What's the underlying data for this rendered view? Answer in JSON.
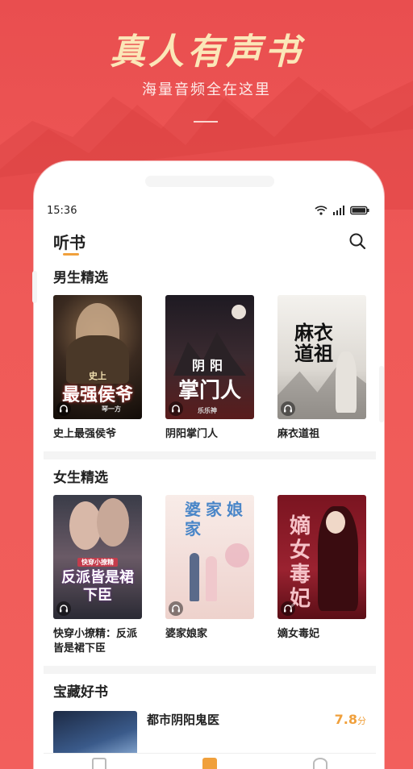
{
  "promo": {
    "title": "真人有声书",
    "subtitle": "海量音频全在这里"
  },
  "status_bar": {
    "time": "15:36"
  },
  "header": {
    "title": "听书"
  },
  "sections": [
    {
      "title": "男生精选",
      "books": [
        {
          "title": "史上最强侯爷",
          "cover_text": "最强侯爷",
          "cover_badge": "史上",
          "cover_author": "琴一方"
        },
        {
          "title": "阴阳掌门人",
          "cover_text": "掌门人",
          "cover_badge": "阴阳",
          "cover_author": "乐乐神"
        },
        {
          "title": "麻衣道祖",
          "cover_text": "麻衣道祖"
        }
      ]
    },
    {
      "title": "女生精选",
      "books": [
        {
          "title": "快穿小撩精：反派皆是裙下臣",
          "cover_text": "反派皆是裙下臣",
          "cover_badge": "快穿小撩精"
        },
        {
          "title": "婆家娘家",
          "cover_text": "婆家娘家"
        },
        {
          "title": "嫡女毒妃",
          "cover_text": "嫡女毒妃"
        }
      ]
    }
  ],
  "treasure": {
    "title": "宝藏好书",
    "items": [
      {
        "title": "都市阴阳鬼医",
        "score": "7.8",
        "score_unit": "分"
      }
    ]
  },
  "colors": {
    "brand_red": "#ef5a58",
    "accent_orange": "#f0a03c",
    "promo_gold": "#fbe7b8"
  },
  "icons": {
    "search": "search-icon",
    "wifi": "wifi-icon",
    "signal": "signal-icon",
    "battery": "battery-icon",
    "headphone": "headphone-icon"
  }
}
